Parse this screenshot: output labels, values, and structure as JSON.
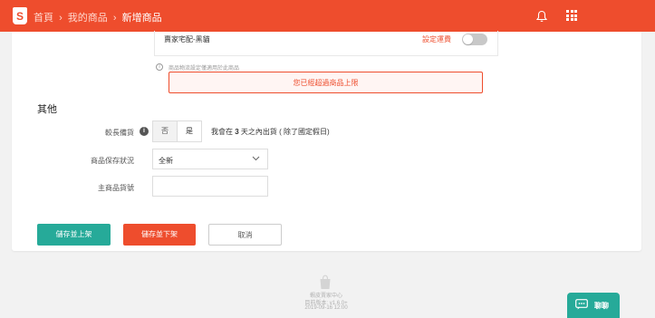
{
  "header": {
    "logo_letter": "S",
    "breadcrumb": {
      "home": "首頁",
      "separator": "›",
      "products": "我的商品",
      "current": "新增商品"
    },
    "icons": [
      "bell-icon",
      "apps-grid-icon"
    ],
    "accent_color": "#ee4d2d"
  },
  "shipping": {
    "method_name": "賣家宅配-黑貓",
    "set_fee_link": "設定運費",
    "toggle_on": false,
    "hint": "商品物流設定僅適用於此商品",
    "error": "您已經超過商品上限"
  },
  "others": {
    "section_title": "其他",
    "preorder": {
      "label": "較長備貨",
      "no": "否",
      "yes": "是",
      "selected": "否",
      "note_prefix": "我會在",
      "days": "3",
      "note_suffix": "天之內出貨 ( 除了國定假日)"
    },
    "condition": {
      "label": "商品保存狀況",
      "value": "全新"
    },
    "parent_sku": {
      "label": "主商品貨號",
      "value": ""
    }
  },
  "actions": {
    "publish": "儲存並上架",
    "delist": "儲存並下架",
    "cancel": "取消",
    "publish_color": "#26aa99"
  },
  "footer": {
    "line1": "蝦皮賣家中心",
    "line2": "目前版本: v1.6.0+",
    "line3": "2019-09-16 12:00"
  },
  "chat": {
    "label": "聊聊"
  }
}
